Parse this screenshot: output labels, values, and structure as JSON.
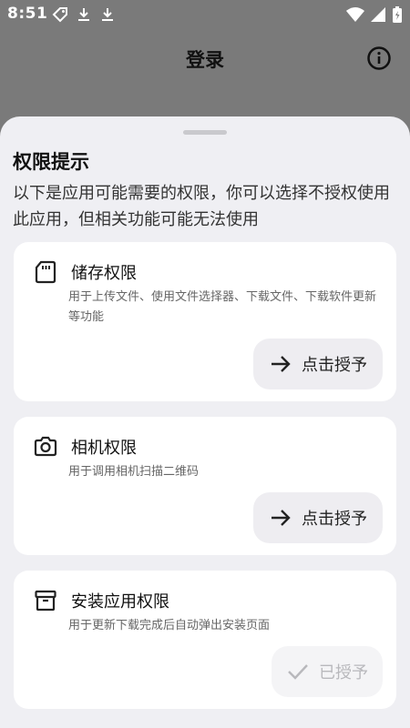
{
  "status_bar": {
    "time": "8:51",
    "left_icons": [
      "tag-icon",
      "download-icon",
      "download-icon"
    ],
    "right_icons": [
      "wifi-icon",
      "signal-icon",
      "battery-icon"
    ]
  },
  "app_bar": {
    "title": "登录",
    "info_icon": "info-icon"
  },
  "sheet": {
    "title": "权限提示",
    "description": "以下是应用可能需要的权限，你可以选择不授权使用此应用，但相关功能可能无法使用",
    "permissions": [
      {
        "icon": "sd-card-icon",
        "title": "储存权限",
        "description": "用于上传文件、使用文件选择器、下载文件、下载软件更新等功能",
        "button_label": "点击授予",
        "button_icon": "arrow-right-icon",
        "granted": false
      },
      {
        "icon": "camera-icon",
        "title": "相机权限",
        "description": "用于调用相机扫描二维码",
        "button_label": "点击授予",
        "button_icon": "arrow-right-icon",
        "granted": false
      },
      {
        "icon": "archive-box-icon",
        "title": "安装应用权限",
        "description": "用于更新下载完成后自动弹出安装页面",
        "button_label": "已授予",
        "button_icon": "check-icon",
        "granted": true
      }
    ]
  },
  "colors": {
    "scrim": "#7a7a7a",
    "sheet_bg": "#efeff3",
    "card_bg": "#ffffff",
    "button_bg": "#eeedf1",
    "disabled_text": "#b8b8bc"
  }
}
